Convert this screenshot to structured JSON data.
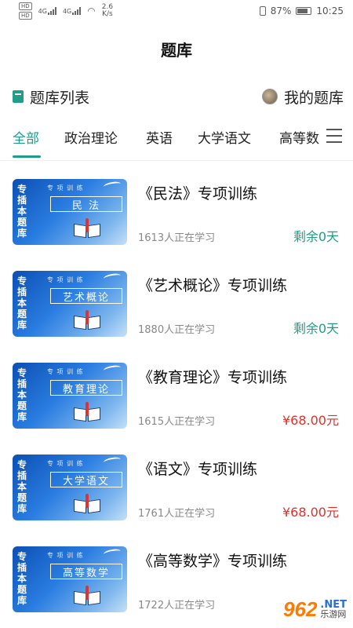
{
  "statusbar": {
    "hd1": "HD",
    "hd2": "HD",
    "sig1": "4G",
    "sig2": "4G",
    "net_speed": "2.6",
    "net_unit": "K/s",
    "battery": "87%",
    "time": "10:25"
  },
  "header": {
    "title": "题库"
  },
  "subheader": {
    "left_label": "题库列表",
    "right_label": "我的题库"
  },
  "tabs": [
    {
      "label": "全部",
      "active": true
    },
    {
      "label": "政治理论"
    },
    {
      "label": "英语"
    },
    {
      "label": "大学语文"
    },
    {
      "label": "高等数"
    }
  ],
  "cover_text": {
    "vertical": "专插本题库",
    "sub": "专 项 训 练"
  },
  "items": [
    {
      "cover_label": "民 法",
      "title": "《民法》专项训练",
      "count": "1613人正在学习",
      "status": "剩余0天",
      "status_type": "free"
    },
    {
      "cover_label": "艺术概论",
      "title": "《艺术概论》专项训练",
      "count": "1880人正在学习",
      "status": "剩余0天",
      "status_type": "free"
    },
    {
      "cover_label": "教育理论",
      "title": "《教育理论》专项训练",
      "count": "1615人正在学习",
      "status": "¥68.00元",
      "status_type": "price"
    },
    {
      "cover_label": "大学语文",
      "title": "《语文》专项训练",
      "count": "1761人正在学习",
      "status": "¥68.00元",
      "status_type": "price"
    },
    {
      "cover_label": "高等数学",
      "title": "《高等数学》专项训练",
      "count": "1722人正在学习",
      "status": "",
      "status_type": "none"
    }
  ],
  "colors": {
    "accent": "#1f9d86",
    "price": "#e0302b"
  },
  "watermark": {
    "logo": "962",
    "domain": ".NET",
    "site": "乐游网"
  }
}
